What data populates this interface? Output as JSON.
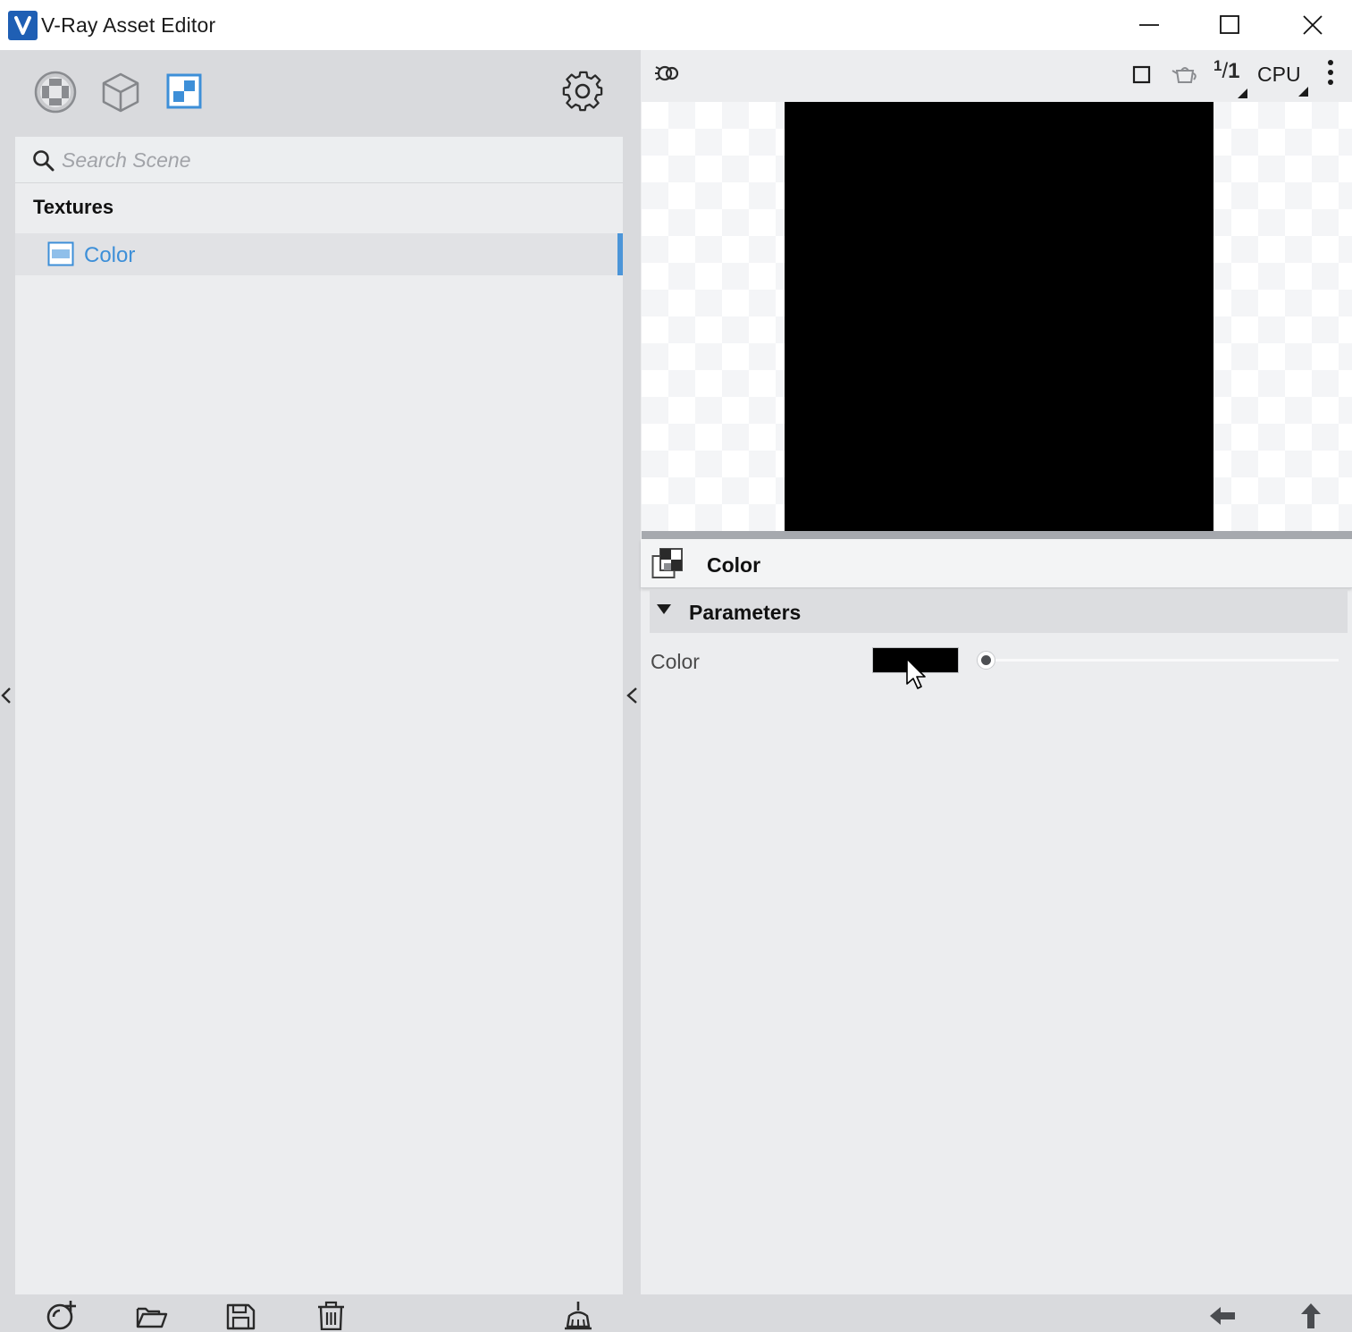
{
  "window": {
    "title": "V-Ray Asset Editor",
    "controls": [
      "minimize-icon",
      "maximize-icon",
      "close-icon"
    ]
  },
  "left_panel": {
    "categories": [
      {
        "name": "materials",
        "icon": "material-sphere-icon",
        "active": false
      },
      {
        "name": "geometry",
        "icon": "cube-icon",
        "active": false
      },
      {
        "name": "textures",
        "icon": "texture-icon",
        "active": true
      }
    ],
    "settings_icon": "gear-icon",
    "search": {
      "placeholder": "Search Scene",
      "value": ""
    },
    "section_title": "Textures",
    "items": [
      {
        "label": "Color",
        "icon": "texture-item-icon",
        "selected": true
      }
    ]
  },
  "preview": {
    "toolbar_icons": [
      "preview-light-icon",
      "render-region-icon",
      "teapot-icon",
      "ratio-icon",
      "more-icon"
    ],
    "ratio_label": "1/1",
    "ratio_num": "1",
    "ratio_den": "1",
    "engine_label": "CPU",
    "render_color": "#000000"
  },
  "asset": {
    "name": "Color",
    "icon": "texture-asset-icon",
    "rollout_title": "Parameters",
    "params": [
      {
        "label": "Color",
        "swatch_color": "#000000",
        "slider_level": 0.0
      }
    ]
  },
  "bottom_bar": {
    "left_icons": [
      "create-asset-icon",
      "open-folder-icon",
      "save-icon",
      "delete-icon",
      "purge-icon"
    ],
    "right_icons": [
      "back-arrow-icon",
      "up-arrow-icon"
    ]
  },
  "colors": {
    "accent": "#4c95d8",
    "panel": "#ecedef",
    "frame": "#d9dadd"
  }
}
